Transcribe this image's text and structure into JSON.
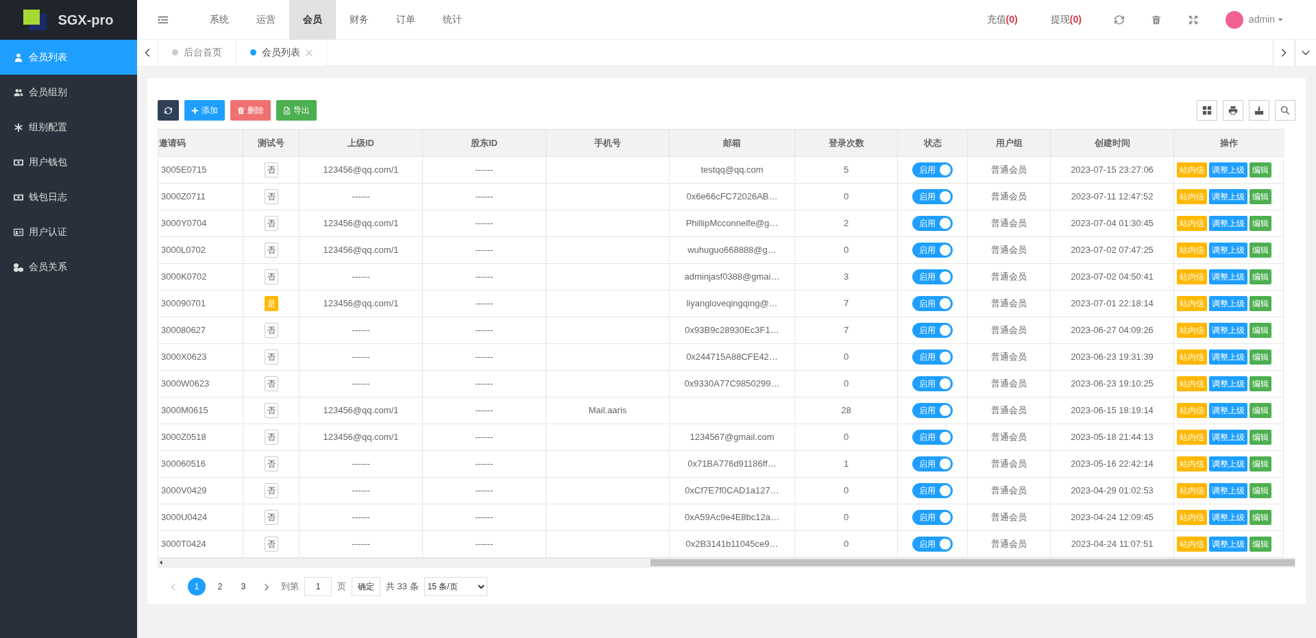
{
  "logo": {
    "text": "SGX-pro"
  },
  "sidebar": {
    "items": [
      {
        "label": "会员列表",
        "selected": true
      },
      {
        "label": "会员组别",
        "selected": false
      },
      {
        "label": "组别配置",
        "selected": false
      },
      {
        "label": "用户钱包",
        "selected": false
      },
      {
        "label": "钱包日志",
        "selected": false
      },
      {
        "label": "用户认证",
        "selected": false
      },
      {
        "label": "会员关系",
        "selected": false
      }
    ]
  },
  "top_nav": {
    "items": [
      {
        "label": "系统",
        "selected": false
      },
      {
        "label": "运营",
        "selected": false
      },
      {
        "label": "会员",
        "selected": true
      },
      {
        "label": "财务",
        "selected": false
      },
      {
        "label": "订单",
        "selected": false
      },
      {
        "label": "统计",
        "selected": false
      }
    ],
    "counters": [
      {
        "label": "充值",
        "count": "(0)"
      },
      {
        "label": "提现",
        "count": "(0)"
      }
    ],
    "user": "admin"
  },
  "page_tabs": [
    {
      "label": "后台首页",
      "selected": false,
      "closable": false
    },
    {
      "label": "会员列表",
      "selected": true,
      "closable": true
    }
  ],
  "toolbar": {
    "buttons": [
      {
        "kind": "refresh"
      },
      {
        "kind": "add",
        "label": "添加"
      },
      {
        "kind": "delete",
        "label": "删除"
      },
      {
        "kind": "export",
        "label": "导出"
      }
    ]
  },
  "table": {
    "columns": [
      "邀请码",
      "测试号",
      "上级ID",
      "股东ID",
      "手机号",
      "邮箱",
      "登录次数",
      "状态",
      "用户组",
      "创建时间",
      "操作"
    ],
    "rows": [
      {
        "invite_code": "3005E0715",
        "test": {
          "label": "否",
          "on": false
        },
        "parent_id": "123456@qq.com/1",
        "shareholder_id": "------",
        "email": "testqq@qq.com",
        "logins": "5",
        "status": {
          "label": "启用",
          "on": true
        },
        "group": "普通会员",
        "created": "2023-07-15 23:27:06",
        "actions": [
          "站内信",
          "调整上级",
          "编辑"
        ]
      },
      {
        "invite_code": "3000Z0711",
        "test": {
          "label": "否",
          "on": false
        },
        "parent_id": "------",
        "shareholder_id": "------",
        "email": "0x6e66cFC72026AB…",
        "logins": "0",
        "status": {
          "label": "启用",
          "on": true
        },
        "group": "普通会员",
        "created": "2023-07-11 12:47:52",
        "actions": [
          "站内信",
          "调整上级",
          "编辑"
        ]
      },
      {
        "invite_code": "3000Y0704",
        "test": {
          "label": "否",
          "on": false
        },
        "parent_id": "123456@qq.com/1",
        "shareholder_id": "------",
        "email": "PhillipMcconnelfe@g…",
        "logins": "2",
        "status": {
          "label": "启用",
          "on": true
        },
        "group": "普通会员",
        "created": "2023-07-04 01:30:45",
        "actions": [
          "站内信",
          "调整上级",
          "编辑"
        ]
      },
      {
        "invite_code": "3000L0702",
        "test": {
          "label": "否",
          "on": false
        },
        "parent_id": "123456@qq.com/1",
        "shareholder_id": "------",
        "email": "wuhuguo668888@g…",
        "logins": "0",
        "status": {
          "label": "启用",
          "on": true
        },
        "group": "普通会员",
        "created": "2023-07-02 07:47:25",
        "actions": [
          "站内信",
          "调整上级",
          "编辑"
        ]
      },
      {
        "invite_code": "3000K0702",
        "test": {
          "label": "否",
          "on": false
        },
        "parent_id": "------",
        "shareholder_id": "------",
        "email": "adminjasf0388@gmai…",
        "logins": "3",
        "status": {
          "label": "启用",
          "on": true
        },
        "group": "普通会员",
        "created": "2023-07-02 04:50:41",
        "actions": [
          "站内信",
          "调整上级",
          "编辑"
        ]
      },
      {
        "invite_code": "300090701",
        "test": {
          "label": "是",
          "on": true
        },
        "parent_id": "123456@qq.com/1",
        "shareholder_id": "------",
        "email": "liyangloveqingqing@…",
        "logins": "7",
        "status": {
          "label": "启用",
          "on": true
        },
        "group": "普通会员",
        "created": "2023-07-01 22:18:14",
        "actions": [
          "站内信",
          "调整上级",
          "编辑"
        ]
      },
      {
        "invite_code": "300080627",
        "test": {
          "label": "否",
          "on": false
        },
        "parent_id": "------",
        "shareholder_id": "------",
        "email": "0x93B9c28930Ec3F1…",
        "logins": "7",
        "status": {
          "label": "启用",
          "on": true
        },
        "group": "普通会员",
        "created": "2023-06-27 04:09:26",
        "actions": [
          "站内信",
          "调整上级",
          "编辑"
        ]
      },
      {
        "invite_code": "3000X0623",
        "test": {
          "label": "否",
          "on": false
        },
        "parent_id": "------",
        "shareholder_id": "------",
        "email": "0x244715A88CFE42…",
        "logins": "0",
        "status": {
          "label": "启用",
          "on": true
        },
        "group": "普通会员",
        "created": "2023-06-23 19:31:39",
        "actions": [
          "站内信",
          "调整上级",
          "编辑"
        ]
      },
      {
        "invite_code": "3000W0623",
        "test": {
          "label": "否",
          "on": false
        },
        "parent_id": "------",
        "shareholder_id": "------",
        "email": "0x9330A77C9850299…",
        "logins": "0",
        "status": {
          "label": "启用",
          "on": true
        },
        "group": "普通会员",
        "created": "2023-06-23 19:10:25",
        "actions": [
          "站内信",
          "调整上级",
          "编辑"
        ]
      },
      {
        "invite_code": "3000M0615",
        "test": {
          "label": "否",
          "on": false
        },
        "parent_id": "123456@qq.com/1",
        "shareholder_id": "------",
        "phone": "Mail.aaris",
        "logins": "28",
        "status": {
          "label": "启用",
          "on": true
        },
        "group": "普通会员",
        "created": "2023-06-15 18:19:14",
        "actions": [
          "站内信",
          "调整上级",
          "编辑"
        ]
      },
      {
        "invite_code": "3000Z0518",
        "test": {
          "label": "否",
          "on": false
        },
        "parent_id": "123456@qq.com/1",
        "shareholder_id": "------",
        "email": "1234567@gmail.com",
        "logins": "0",
        "status": {
          "label": "启用",
          "on": true
        },
        "group": "普通会员",
        "created": "2023-05-18 21:44:13",
        "actions": [
          "站内信",
          "调整上级",
          "编辑"
        ]
      },
      {
        "invite_code": "300060516",
        "test": {
          "label": "否",
          "on": false
        },
        "parent_id": "------",
        "shareholder_id": "------",
        "email": "0x71BA776d91186ff…",
        "logins": "1",
        "status": {
          "label": "启用",
          "on": true
        },
        "group": "普通会员",
        "created": "2023-05-16 22:42:14",
        "actions": [
          "站内信",
          "调整上级",
          "编辑"
        ]
      },
      {
        "invite_code": "3000V0429",
        "test": {
          "label": "否",
          "on": false
        },
        "parent_id": "------",
        "shareholder_id": "------",
        "email": "0xCf7E7f0CAD1a127…",
        "logins": "0",
        "status": {
          "label": "启用",
          "on": true
        },
        "group": "普通会员",
        "created": "2023-04-29 01:02:53",
        "actions": [
          "站内信",
          "调整上级",
          "编辑"
        ]
      },
      {
        "invite_code": "3000U0424",
        "test": {
          "label": "否",
          "on": false
        },
        "parent_id": "------",
        "shareholder_id": "------",
        "email": "0xA59Ac9e4E8bc12a…",
        "logins": "0",
        "status": {
          "label": "启用",
          "on": true
        },
        "group": "普通会员",
        "created": "2023-04-24 12:09:45",
        "actions": [
          "站内信",
          "调整上级",
          "编辑"
        ]
      },
      {
        "invite_code": "3000T0424",
        "test": {
          "label": "否",
          "on": false
        },
        "parent_id": "------",
        "shareholder_id": "------",
        "email": "0x2B3141b11045ce9…",
        "logins": "0",
        "status": {
          "label": "启用",
          "on": true
        },
        "group": "普通会员",
        "created": "2023-04-24 11:07:51",
        "actions": [
          "站内信",
          "调整上级",
          "编辑"
        ]
      }
    ]
  },
  "pagination": {
    "pages": [
      {
        "label": "1",
        "selected": true
      },
      {
        "label": "2",
        "selected": false
      },
      {
        "label": "3",
        "selected": false
      }
    ],
    "goto_label": "到第",
    "goto_value": "1",
    "page_unit": "页",
    "confirm": "确定",
    "total": "共 33 条",
    "page_size": "15 条/页"
  }
}
